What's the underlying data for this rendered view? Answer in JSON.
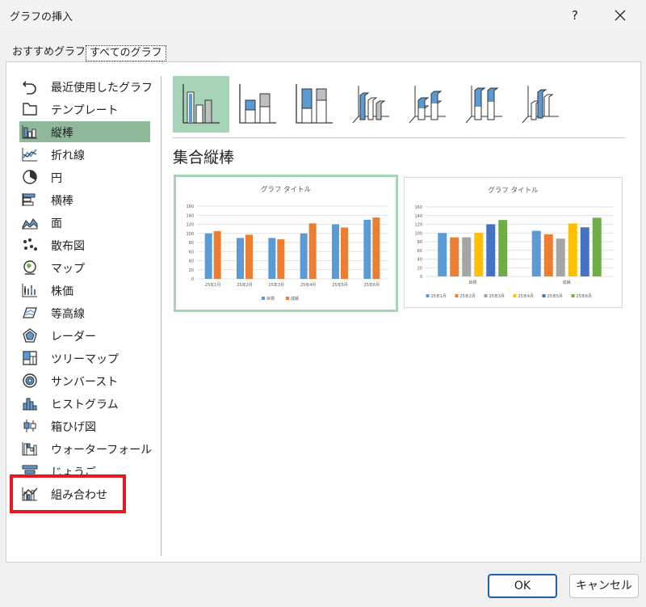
{
  "dialog": {
    "title": "グラフの挿入",
    "help_label": "?"
  },
  "tabs": [
    "おすすめグラフ",
    "すべてのグラフ"
  ],
  "categories": [
    {
      "label": "最近使用したグラフ",
      "icon": "recent-icon"
    },
    {
      "label": "テンプレート",
      "icon": "template-folder-icon"
    },
    {
      "label": "縦棒",
      "icon": "column-chart-icon",
      "selected": true
    },
    {
      "label": "折れ線",
      "icon": "line-chart-icon"
    },
    {
      "label": "円",
      "icon": "pie-chart-icon"
    },
    {
      "label": "横棒",
      "icon": "bar-chart-icon"
    },
    {
      "label": "面",
      "icon": "area-chart-icon"
    },
    {
      "label": "散布図",
      "icon": "scatter-chart-icon"
    },
    {
      "label": "マップ",
      "icon": "map-chart-icon"
    },
    {
      "label": "株価",
      "icon": "stock-chart-icon"
    },
    {
      "label": "等高線",
      "icon": "surface-chart-icon"
    },
    {
      "label": "レーダー",
      "icon": "radar-chart-icon"
    },
    {
      "label": "ツリーマップ",
      "icon": "treemap-chart-icon"
    },
    {
      "label": "サンバースト",
      "icon": "sunburst-chart-icon"
    },
    {
      "label": "ヒストグラム",
      "icon": "histogram-chart-icon"
    },
    {
      "label": "箱ひげ図",
      "icon": "box-whisker-chart-icon"
    },
    {
      "label": "ウォーターフォール",
      "icon": "waterfall-chart-icon"
    },
    {
      "label": "じょうご",
      "icon": "funnel-chart-icon"
    },
    {
      "label": "組み合わせ",
      "icon": "combo-chart-icon"
    }
  ],
  "chart_type_title": "集合縦棒",
  "colors": {
    "selection": "#8fb99a",
    "subtype_selected": "#a7d3b7",
    "highlight_box": "#e81820",
    "series_blue": "#5b9bd5",
    "series_orange": "#ed7d31",
    "series_gray": "#a5a5a5",
    "series_yellow": "#ffc000",
    "series_darkblue": "#4472c4",
    "series_green": "#70ad47"
  },
  "chart_data": [
    {
      "type": "bar",
      "title": "グラフ タイトル",
      "categories": [
        "25年1月",
        "25年2月",
        "25年3月",
        "25年4月",
        "25年5月",
        "25年6月"
      ],
      "series": [
        {
          "name": "目標",
          "values": [
            100,
            90,
            90,
            100,
            120,
            130
          ]
        },
        {
          "name": "成績",
          "values": [
            105,
            97,
            87,
            122,
            113,
            135
          ]
        }
      ],
      "ylim": [
        0,
        160
      ],
      "yticks": [
        0,
        20,
        40,
        60,
        80,
        100,
        120,
        140,
        160
      ],
      "grid": true,
      "legend": "bottom"
    },
    {
      "type": "bar",
      "title": "グラフ タイトル",
      "categories": [
        "目標",
        "成績"
      ],
      "series": [
        {
          "name": "25年1月",
          "values": [
            100,
            105
          ]
        },
        {
          "name": "25年2月",
          "values": [
            90,
            97
          ]
        },
        {
          "name": "25年3月",
          "values": [
            90,
            87
          ]
        },
        {
          "name": "25年4月",
          "values": [
            100,
            122
          ]
        },
        {
          "name": "25年5月",
          "values": [
            120,
            113
          ]
        },
        {
          "name": "25年6月",
          "values": [
            130,
            135
          ]
        }
      ],
      "ylim": [
        0,
        160
      ],
      "yticks": [
        0,
        20,
        40,
        60,
        80,
        100,
        120,
        140,
        160
      ],
      "grid": true,
      "legend": "bottom"
    }
  ],
  "buttons": {
    "ok": "OK",
    "cancel": "キャンセル"
  }
}
